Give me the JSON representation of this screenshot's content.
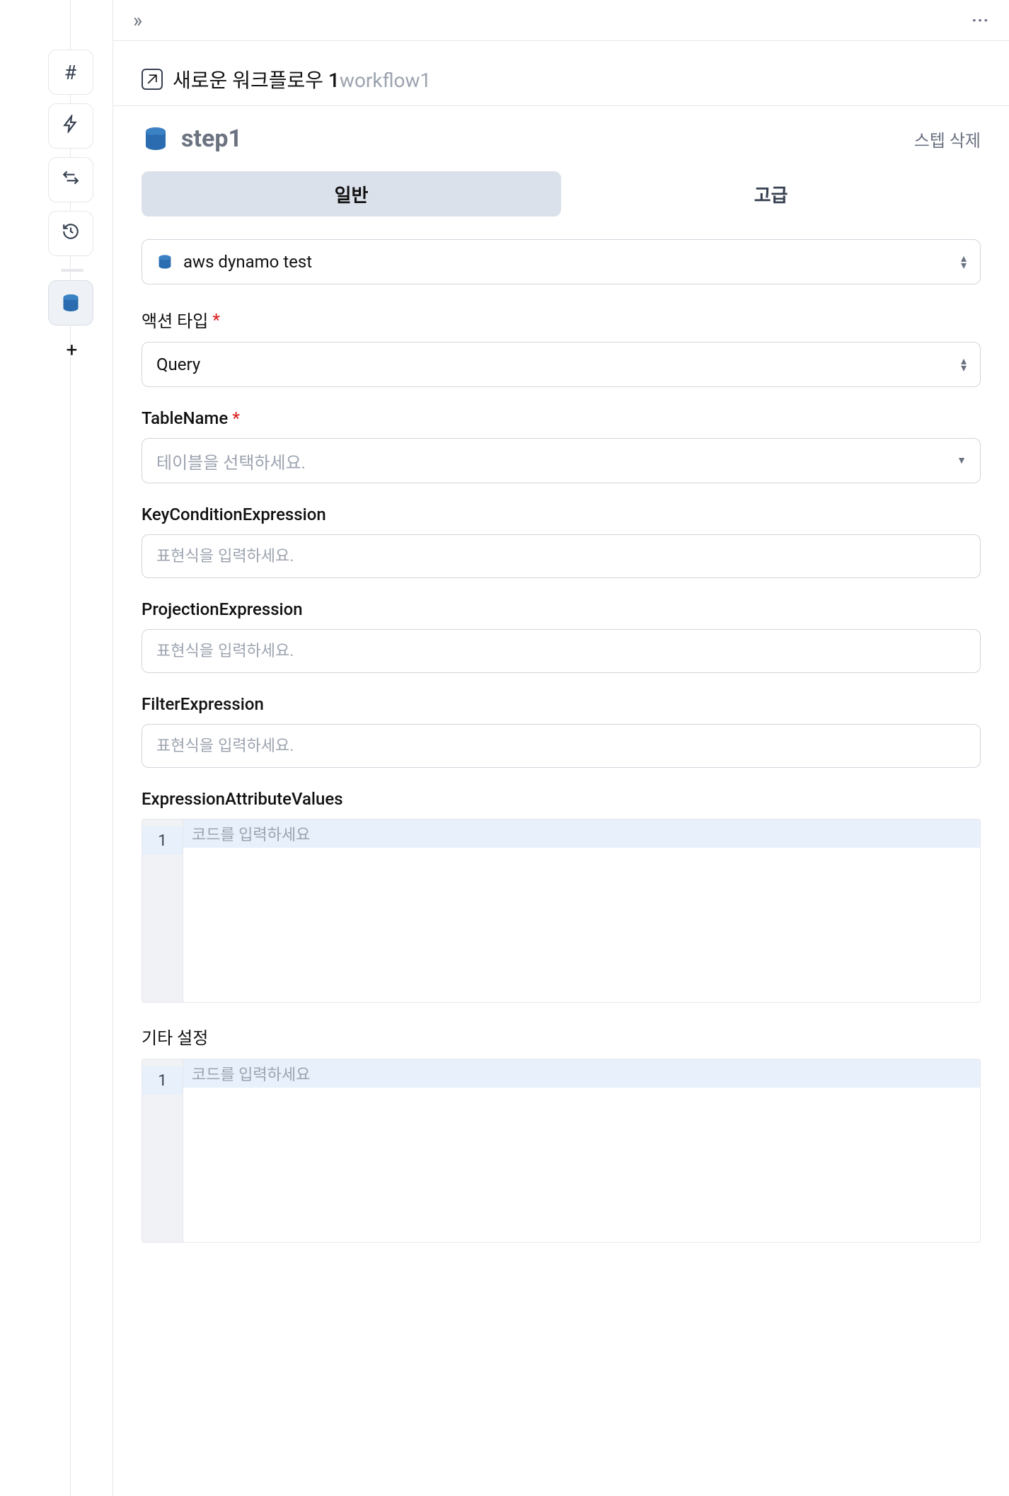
{
  "breadcrumb": {
    "title": "새로운 워크플로우 1",
    "subtitle": "workflow1"
  },
  "step": {
    "name": "step1",
    "deleteLabel": "스텝 삭제"
  },
  "tabs": {
    "general": "일반",
    "advanced": "고급"
  },
  "datasource": {
    "selected": "aws dynamo test"
  },
  "fields": {
    "actionType": {
      "label": "액션 타입",
      "value": "Query"
    },
    "tableName": {
      "label": "TableName",
      "placeholder": "테이블을 선택하세요."
    },
    "keyCondition": {
      "label": "KeyConditionExpression",
      "placeholder": "표현식을 입력하세요."
    },
    "projection": {
      "label": "ProjectionExpression",
      "placeholder": "표현식을 입력하세요."
    },
    "filter": {
      "label": "FilterExpression",
      "placeholder": "표현식을 입력하세요."
    },
    "exprAttrValues": {
      "label": "ExpressionAttributeValues",
      "placeholder": "코드를 입력하세요",
      "lineNumber": "1"
    },
    "other": {
      "label": "기타 설정",
      "placeholder": "코드를 입력하세요",
      "lineNumber": "1"
    }
  }
}
